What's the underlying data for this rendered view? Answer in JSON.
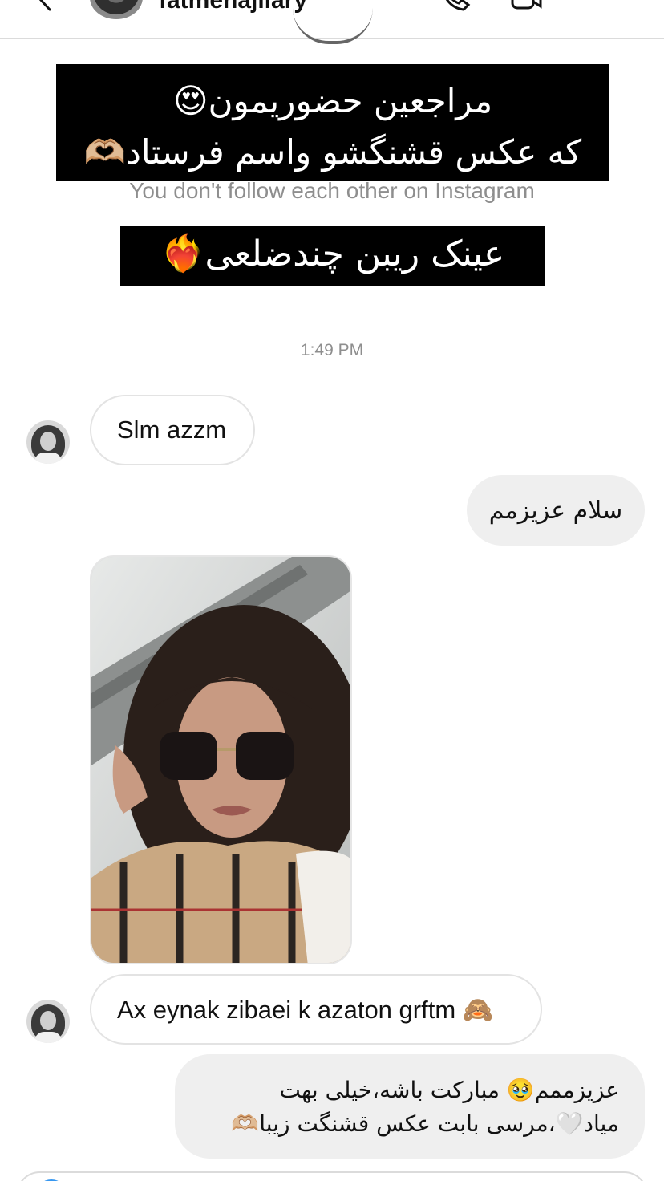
{
  "header": {
    "username": "fatmehajilary",
    "back_icon": "chevron-left-icon",
    "call_icon": "phone-icon",
    "video_icon": "video-camera-icon",
    "flag_icon": "flag-icon"
  },
  "story_reply": {
    "banner_line1": "مراجعین حضوریمون😍",
    "banner_line2": "که عکس قشنگشو واسم فرستاد🫶🏼",
    "notice": "You don't follow each other on Instagram",
    "banner2": "عینک ریبن چندضلعی❤️‍🔥"
  },
  "timestamp": "1:49 PM",
  "messages": [
    {
      "from": "them",
      "text": "Slm azzm"
    },
    {
      "from": "me",
      "text": "سلام عزیزمم"
    },
    {
      "from": "them",
      "type": "photo"
    },
    {
      "from": "them",
      "text": "Ax eynak zibaei k azaton grftm 🙈"
    },
    {
      "from": "me",
      "line1": "عزیزممم🥹 مبارکت باشه،خیلی بهت",
      "line2": "میاد🤍،مرسی بابت عکس قشنگت زیبا🫶🏼"
    }
  ],
  "colors": {
    "accent": "#3797f0",
    "bubble_out": "#efefef",
    "muted": "#8e8e8e"
  }
}
